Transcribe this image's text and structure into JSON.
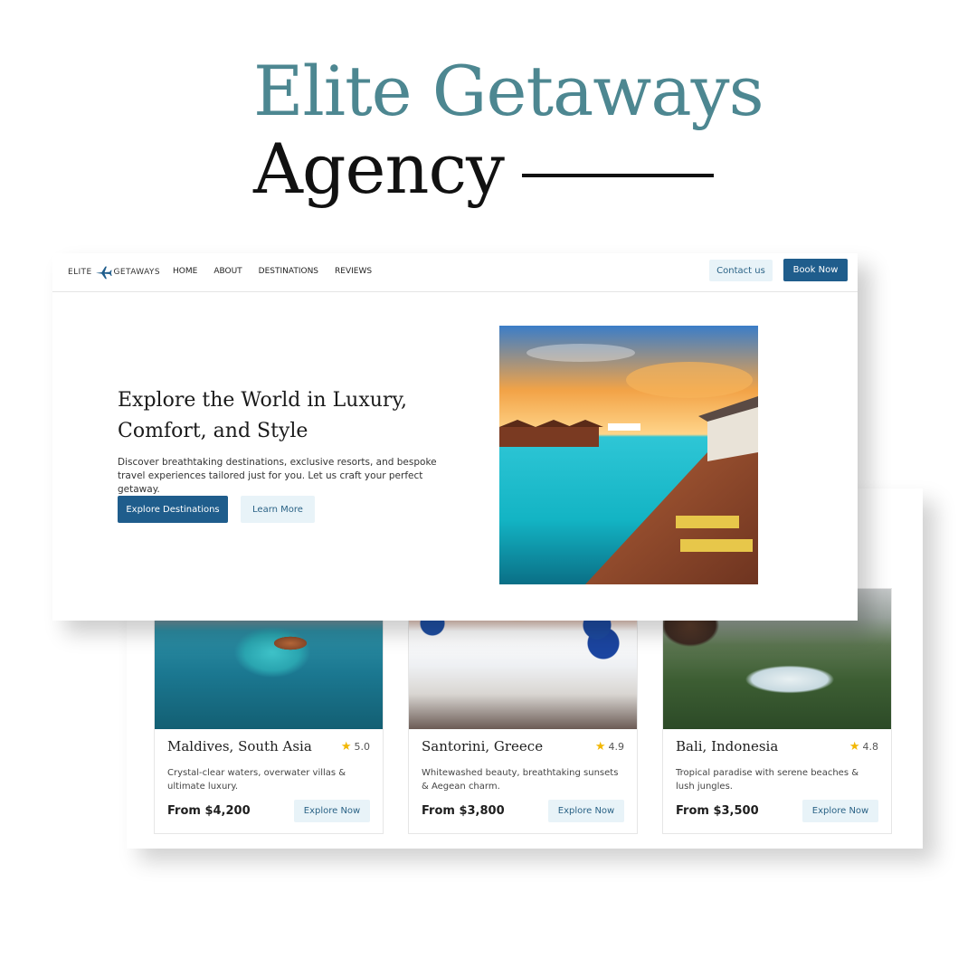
{
  "headline": {
    "line1": "Elite Getaways",
    "line2": "Agency"
  },
  "nav": {
    "logo_left": "ELITE",
    "logo_right": "GETAWAYS",
    "links": [
      "HOME",
      "ABOUT",
      "DESTINATIONS",
      "REVIEWS"
    ],
    "contact_label": "Contact us",
    "book_label": "Book Now"
  },
  "hero": {
    "title": "Explore the World in Luxury, Comfort, and Style",
    "subtitle": "Discover breathtaking destinations, exclusive resorts, and bespoke travel experiences tailored just for you. Let us craft your perfect getaway.",
    "primary_button": "Explore Destinations",
    "secondary_button": "Learn More"
  },
  "destinations": [
    {
      "name": "Maldives, South Asia",
      "rating": "5.0",
      "description": "Crystal-clear waters, overwater villas & ultimate luxury.",
      "price": "From $4,200",
      "button": "Explore Now"
    },
    {
      "name": "Santorini, Greece",
      "rating": "4.9",
      "description": "Whitewashed beauty, breathtaking sunsets & Aegean charm.",
      "price": "From $3,800",
      "button": "Explore Now"
    },
    {
      "name": "Bali, Indonesia",
      "rating": "4.8",
      "description": "Tropical paradise with serene beaches & lush jungles.",
      "price": "From $3,500",
      "button": "Explore Now"
    }
  ],
  "colors": {
    "accent_teal": "#4d8791",
    "primary_blue": "#1f5d8c",
    "light_button": "#e8f3f8",
    "star": "#f2b705"
  },
  "icons": {
    "logo": "airplane-icon",
    "rating": "star-icon"
  }
}
